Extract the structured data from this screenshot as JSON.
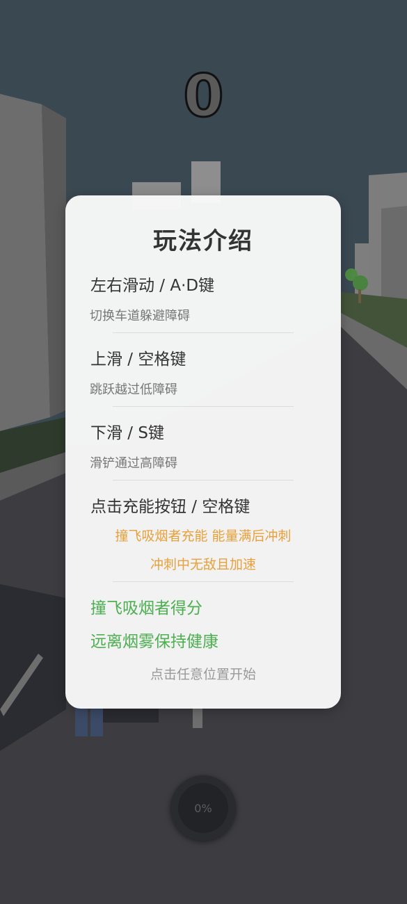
{
  "score": "0",
  "panel": {
    "title": "玩法介绍",
    "rules": [
      {
        "heading": "左右滑动 / A·D键",
        "desc": "切换车道躲避障碍"
      },
      {
        "heading": "上滑 / 空格键",
        "desc": "跳跃越过低障碍"
      },
      {
        "heading": "下滑 / S键",
        "desc": "滑铲通过高障碍"
      },
      {
        "heading": "点击充能按钮 / 空格键"
      }
    ],
    "charge_line1": "撞飞吸烟者充能  能量满后冲刺",
    "charge_line2": "冲刺中无敌且加速",
    "goal_score": "撞飞吸烟者得分",
    "goal_health": "远离烟雾保持健康",
    "start_hint": "点击任意位置开始"
  },
  "charge_button": {
    "progress_label": "0%",
    "progress": 0
  },
  "colors": {
    "sky": "#3a4852",
    "road": "#3d3c41",
    "orange_text": "#e8a03a",
    "green_text": "#4caf50"
  }
}
